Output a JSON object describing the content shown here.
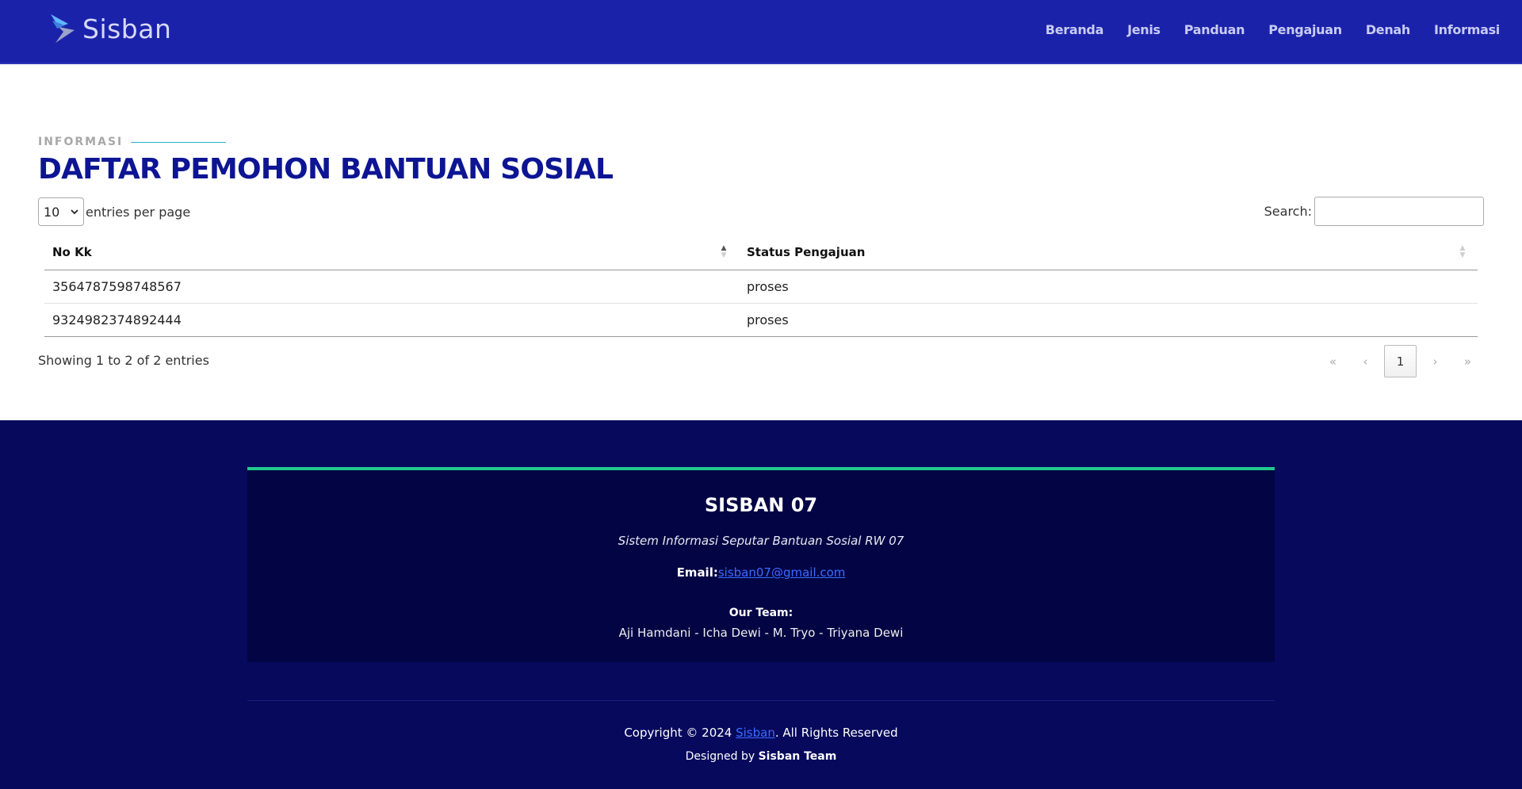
{
  "header": {
    "brand": "Sisban",
    "nav": [
      "Beranda",
      "Jenis",
      "Panduan",
      "Pengajuan",
      "Denah",
      "Informasi"
    ],
    "colors": {
      "background": "#1b22aa",
      "nav_text": "#c9ccf3"
    }
  },
  "section": {
    "eyebrow": "INFORMASI",
    "title": "DAFTAR PEMOHON BANTUAN SOSIAL"
  },
  "table_controls": {
    "entries_value": "10",
    "entries_label": "entries per page",
    "search_label": "Search:",
    "search_value": ""
  },
  "table": {
    "columns": [
      "No Kk",
      "Status Pengajuan"
    ],
    "sort": {
      "column": "No Kk",
      "direction": "ascending"
    },
    "rows": [
      [
        "3564787598748567",
        "proses"
      ],
      [
        "9324982374892444",
        "proses"
      ]
    ]
  },
  "info": "Showing 1 to 2 of 2 entries",
  "pagination": {
    "first": "«",
    "prev": "‹",
    "current": "1",
    "next": "›",
    "last": "»"
  },
  "footer": {
    "brand": "SISBAN 07",
    "tagline": "Sistem Informasi Seputar Bantuan Sosial RW 07",
    "email_label": "Email:",
    "email": "sisban07@gmail.com",
    "team_label": "Our Team:",
    "team": "Aji Hamdani - Icha Dewi - M. Tryo - Triyana Dewi",
    "copyright_prefix": "Copyright © 2024 ",
    "copyright_link": "Sisban",
    "copyright_suffix": ". All Rights Reserved",
    "designed_prefix": "Designed by ",
    "designed_by": "Sisban Team",
    "colors": {
      "background": "#06095c",
      "card": "#020443",
      "accent": "#21c98f",
      "link": "#3b6bff"
    }
  }
}
